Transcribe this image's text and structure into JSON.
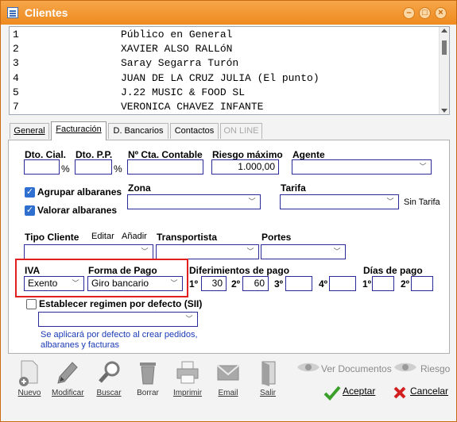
{
  "window": {
    "title": "Clientes"
  },
  "clients": [
    {
      "num": "1",
      "name": "Público en General"
    },
    {
      "num": "2",
      "name": "XAVIER ALSO RALLóN"
    },
    {
      "num": "3",
      "name": "Saray Segarra Turón"
    },
    {
      "num": "4",
      "name": "JUAN DE LA CRUZ JULIA (El punto)"
    },
    {
      "num": "5",
      "name": "J.22 MUSIC & FOOD SL"
    },
    {
      "num": "7",
      "name": "VERONICA CHAVEZ INFANTE"
    }
  ],
  "tabs": [
    {
      "label": "General"
    },
    {
      "label": "Facturación",
      "active": true
    },
    {
      "label": "D. Bancarios"
    },
    {
      "label": "Contactos"
    },
    {
      "label": "ON LINE",
      "disabled": true
    }
  ],
  "form": {
    "dto_cial_label": "Dto. Cial.",
    "dto_pp_label": "Dto. P.P.",
    "percent": "%",
    "cta_contable_label": "Nº Cta. Contable",
    "riesgo_label": "Riesgo máximo",
    "riesgo_value": "1.000,00",
    "agente_label": "Agente",
    "agrupar_label": "Agrupar albaranes",
    "valorar_label": "Valorar albaranes",
    "zona_label": "Zona",
    "tarifa_label": "Tarifa",
    "sin_tarifa": "Sin Tarifa",
    "tipo_cliente_label": "Tipo Cliente",
    "editar": "Editar",
    "anadir": "Añadir",
    "transportista_label": "Transportista",
    "portes_label": "Portes",
    "iva_label": "IVA",
    "iva_value": "Exento",
    "forma_pago_label": "Forma de Pago",
    "forma_pago_value": "Giro bancario",
    "diferimientos_label": "Diferimientos de pago",
    "dif1": "1º",
    "dif1_value": "30",
    "dif2": "2º",
    "dif2_value": "60",
    "dif3": "3º",
    "dif4": "4º",
    "dias_pago_label": "Días de pago",
    "dia1": "1º",
    "dia2": "2º",
    "regimen_label": "Establecer regimen por defecto (SII)",
    "note_line1": "Se aplicará por defecto al crear pedidos,",
    "note_line2": "albaranes y facturas"
  },
  "toolbar": [
    {
      "label": "Nuevo",
      "icon": "new-doc-icon"
    },
    {
      "label": "Modificar",
      "icon": "pencil-icon"
    },
    {
      "label": "Buscar",
      "icon": "magnifier-icon"
    },
    {
      "label": "Borrar",
      "icon": "trash-icon"
    },
    {
      "label": "Imprimir",
      "icon": "printer-icon"
    },
    {
      "label": "Email",
      "icon": "envelope-icon"
    },
    {
      "label": "Salir",
      "icon": "door-icon"
    }
  ],
  "right_actions": {
    "ver_documentos": "Ver Documentos",
    "riesgo": "Riesgo",
    "aceptar": "Aceptar",
    "cancelar": "Cancelar"
  }
}
